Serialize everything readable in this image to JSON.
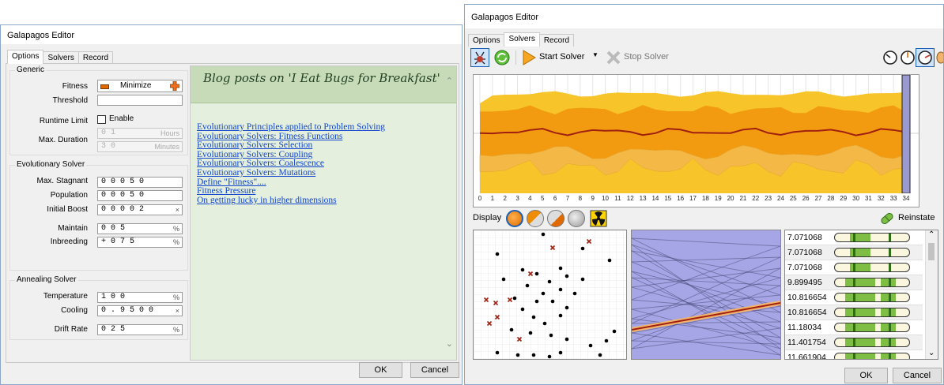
{
  "left_window": {
    "title": "Galapagos Editor",
    "tabs": [
      "Options",
      "Solvers",
      "Record"
    ],
    "generic": {
      "title": "Generic",
      "fitness_label": "Fitness",
      "fitness_value": "Minimize",
      "threshold_label": "Threshold",
      "threshold_value": "",
      "runtime_label": "Runtime Limit",
      "enable_label": "Enable",
      "enable_checked": false,
      "duration_label": "Max. Duration",
      "hours_value": "0 1",
      "hours_unit": "Hours",
      "minutes_value": "3 0",
      "minutes_unit": "Minutes"
    },
    "evolutionary": {
      "title": "Evolutionary Solver",
      "stagnant_label": "Max. Stagnant",
      "stagnant_value": "0 0 0 5 0",
      "population_label": "Population",
      "population_value": "0 0 0 5 0",
      "boost_label": "Initial Boost",
      "boost_value": "0 0 0 0 2",
      "boost_unit": "×",
      "maintain_label": "Maintain",
      "maintain_value": "0 0 5",
      "maintain_unit": "%",
      "inbreeding_label": "Inbreeding",
      "inbreeding_value": "+ 0 7 5",
      "inbreeding_unit": "%"
    },
    "annealing": {
      "title": "Annealing Solver",
      "temperature_label": "Temperature",
      "temperature_value": "1 0 0",
      "temperature_unit": "%",
      "cooling_label": "Cooling",
      "cooling_value": "0 . 9 5 0 0",
      "cooling_unit": "×",
      "drift_label": "Drift Rate",
      "drift_value": "0 2 5",
      "drift_unit": "%"
    },
    "blog": {
      "title": "Blog posts on 'I Eat Bugs for Breakfast'",
      "links": [
        "Evolutionary Principles applied to Problem Solving",
        "Evolutionary Solvers: Fitness Functions",
        "Evolutionary Solvers: Selection",
        "Evolutionary Solvers: Coupling",
        "Evolutionary Solvers: Coalescence",
        "Evolutionary Solvers: Mutations",
        "Define \"Fitness\"....",
        "Fitness Pressure",
        "On getting lucky in higher dimensions"
      ]
    },
    "ok_label": "OK",
    "cancel_label": "Cancel"
  },
  "right_window": {
    "title": "Galapagos Editor",
    "tabs": [
      "Options",
      "Solvers",
      "Record"
    ],
    "toolbar": {
      "start_label": "Start Solver",
      "stop_label": "Stop Solver"
    },
    "generation_ticks": [
      "0",
      "1",
      "2",
      "3",
      "4",
      "5",
      "6",
      "7",
      "8",
      "9",
      "10",
      "11",
      "12",
      "13",
      "14",
      "15",
      "16",
      "17",
      "18",
      "19",
      "20",
      "21",
      "22",
      "23",
      "24",
      "25",
      "26",
      "27",
      "28",
      "29",
      "30",
      "31",
      "32",
      "33",
      "34"
    ],
    "display_label": "Display",
    "reinstate_label": "Reinstate",
    "fitness_values": [
      "7.071068",
      "7.071068",
      "7.071068",
      "9.899495",
      "10.816654",
      "10.816654",
      "11.18034",
      "11.401754",
      "11.661904"
    ],
    "ok_label": "OK",
    "cancel_label": "Cancel",
    "colors": {
      "band_outer": "#f7b500",
      "band_mid": "#f08c00",
      "band_inner": "#e06a00",
      "best_line": "#a01f10",
      "accent_selected": "#1a5fb4"
    }
  }
}
